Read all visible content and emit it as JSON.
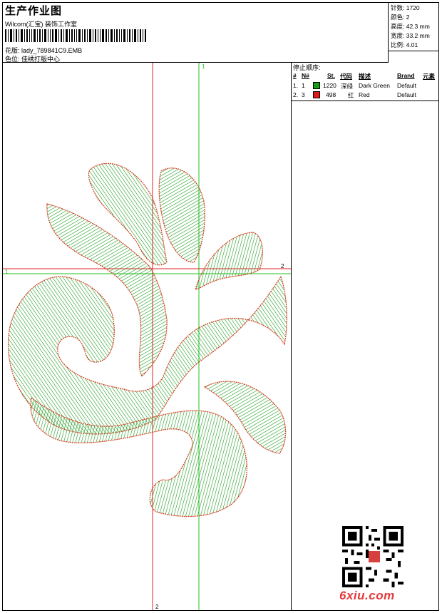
{
  "header": {
    "title": "生产作业图",
    "studio": "Wilcom(汇宝) 装饰工作室",
    "design_file_label": "花版:",
    "design_file": "lady_789841C9.EMB",
    "color_position_label": "色位:",
    "color_position": "佳绣打版中心"
  },
  "stats": {
    "stitches": "针数: 1720",
    "colors": "颜色: 2",
    "height": "高度: 42.3 mm",
    "width": "宽度: 33.2 mm",
    "scale": "比例: 4.01"
  },
  "stop_sequence": {
    "title": "停止顺序:",
    "headers": [
      "#",
      "N#",
      "St.",
      "代码",
      "描述",
      "Brand",
      "元素"
    ],
    "rows": [
      {
        "index": "1.",
        "n": "1",
        "stitches": "1220",
        "code": "深绿",
        "description": "Dark Green",
        "brand": "Default",
        "color": "#1a9a1a"
      },
      {
        "index": "2.",
        "n": "3",
        "stitches": "498",
        "code": "红",
        "description": "Red",
        "brand": "Default",
        "color": "#e01818"
      }
    ]
  },
  "guides": {
    "vertical_green_label": "1",
    "horizontal_green_label": "1",
    "horizontal_red_label": "2",
    "vertical_red_label": "2",
    "green_color": "#22c022",
    "red_color": "#e02020"
  },
  "design_colors": {
    "fill": "#1c9a1c",
    "outline": "#d43a1a"
  },
  "watermark": "6xiu.com"
}
